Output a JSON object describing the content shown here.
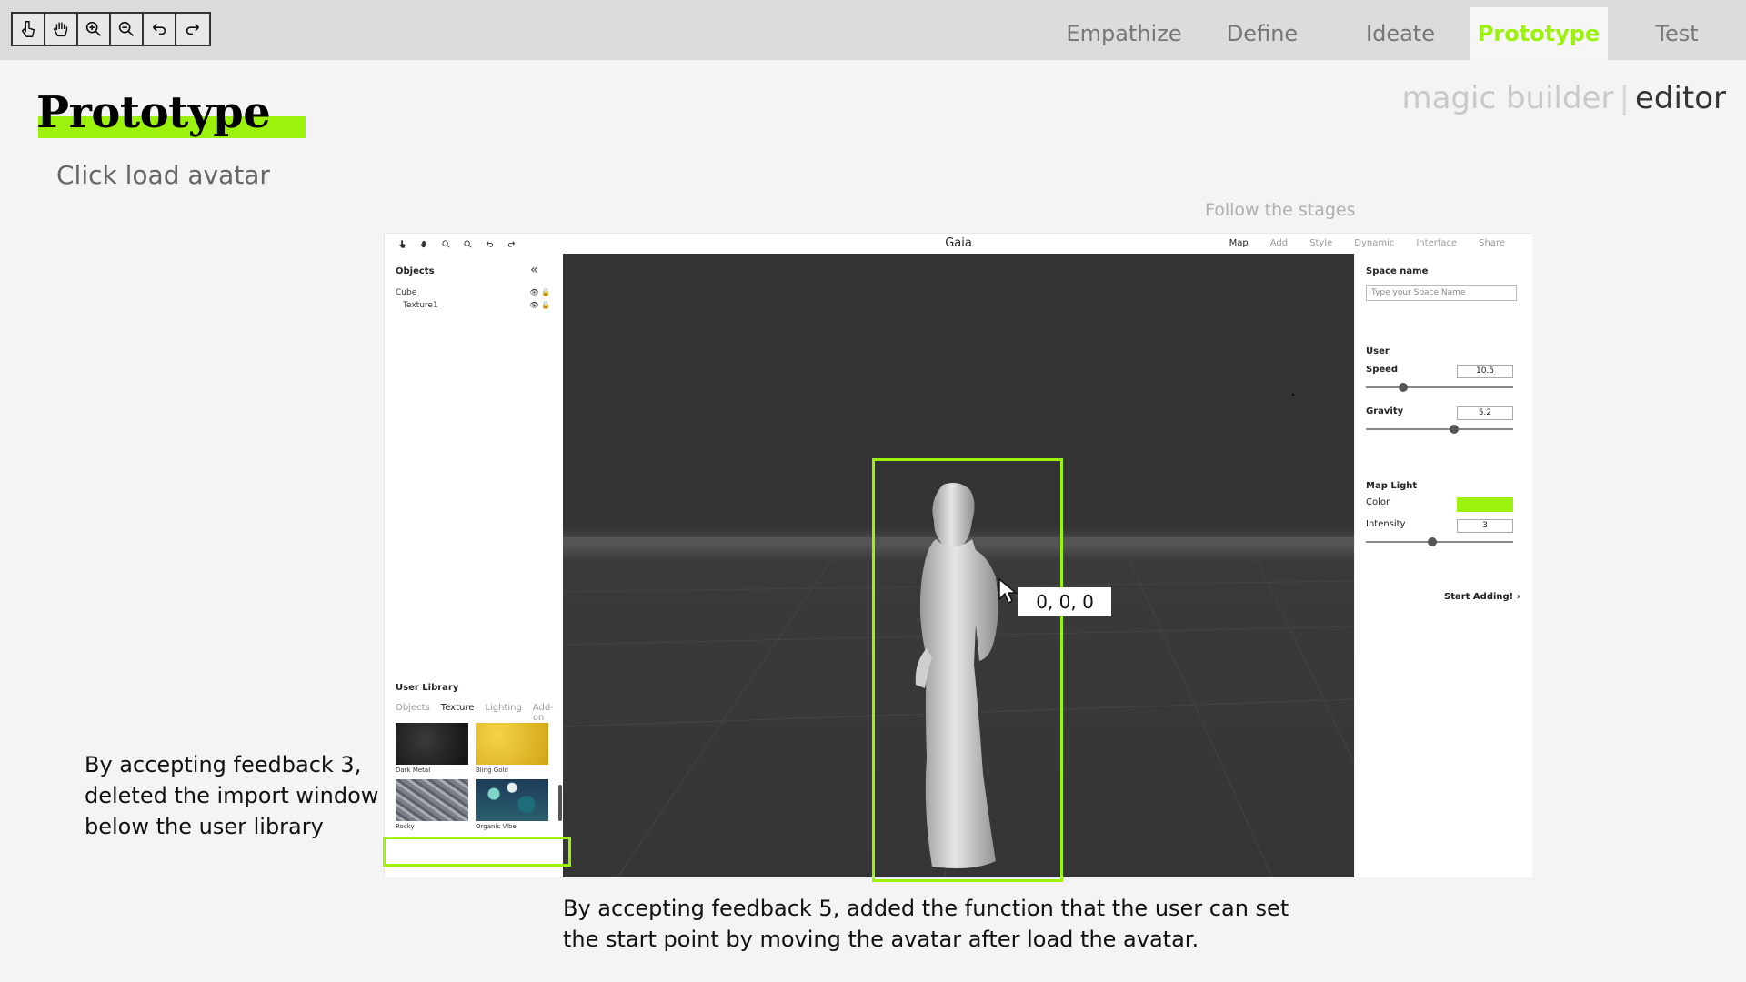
{
  "toolbar": {
    "tools": [
      "pointer-icon",
      "hand-icon",
      "zoom-in-icon",
      "zoom-out-icon",
      "undo-icon",
      "redo-icon"
    ]
  },
  "stages": [
    {
      "label": "Empathize",
      "active": false
    },
    {
      "label": "Define",
      "active": false
    },
    {
      "label": "Ideate",
      "active": false
    },
    {
      "label": "Prototype",
      "active": true
    },
    {
      "label": "Test",
      "active": false
    }
  ],
  "heading": {
    "title": "Prototype",
    "subtitle": "Click load avatar"
  },
  "mode": {
    "inactive": "magic builder",
    "separator": "|",
    "active": "editor"
  },
  "follow_label": "Follow the stages",
  "app": {
    "title": "Gaia",
    "nav": [
      {
        "label": "Map",
        "active": true
      },
      {
        "label": "Add",
        "active": false
      },
      {
        "label": "Style",
        "active": false
      },
      {
        "label": "Dynamic",
        "active": false
      },
      {
        "label": "Interface",
        "active": false
      },
      {
        "label": "Share",
        "active": false
      }
    ],
    "objects_panel": {
      "title": "Objects",
      "collapse_glyph": "«",
      "items": [
        {
          "name": "Cube"
        },
        {
          "name": "Texture1"
        }
      ]
    },
    "user_library": {
      "title": "User Library",
      "tabs": [
        {
          "label": "Objects",
          "active": false
        },
        {
          "label": "Texture",
          "active": true
        },
        {
          "label": "Lighting",
          "active": false
        },
        {
          "label": "Add-on",
          "active": false
        }
      ],
      "textures": [
        {
          "label": "Dark Metal"
        },
        {
          "label": "Bling Gold"
        },
        {
          "label": "Rocky"
        },
        {
          "label": "Organic Vibe"
        }
      ]
    },
    "right_panel": {
      "space_name_label": "Space name",
      "space_name_placeholder": "Type your Space Name",
      "user_label": "User",
      "speed_label": "Speed",
      "speed_value": "10.5",
      "speed_fraction": 0.25,
      "gravity_label": "Gravity",
      "gravity_value": "5.2",
      "gravity_fraction": 0.6,
      "map_light_label": "Map Light",
      "color_label": "Color",
      "color_value": "#9cf20c",
      "intensity_label": "Intensity",
      "intensity_value": "3",
      "intensity_fraction": 0.45,
      "start_button": "Start Adding!",
      "start_chevron": "›"
    },
    "coordinate_readout": "0, 0, 0"
  },
  "notes": {
    "left": "By accepting feedback 3, deleted the import window below the user library",
    "bottom": "By accepting feedback 5, added the function that the user can set the start point by moving the avatar after load the avatar."
  },
  "colors": {
    "accent": "#9cf20c",
    "viewport": "#333333"
  }
}
